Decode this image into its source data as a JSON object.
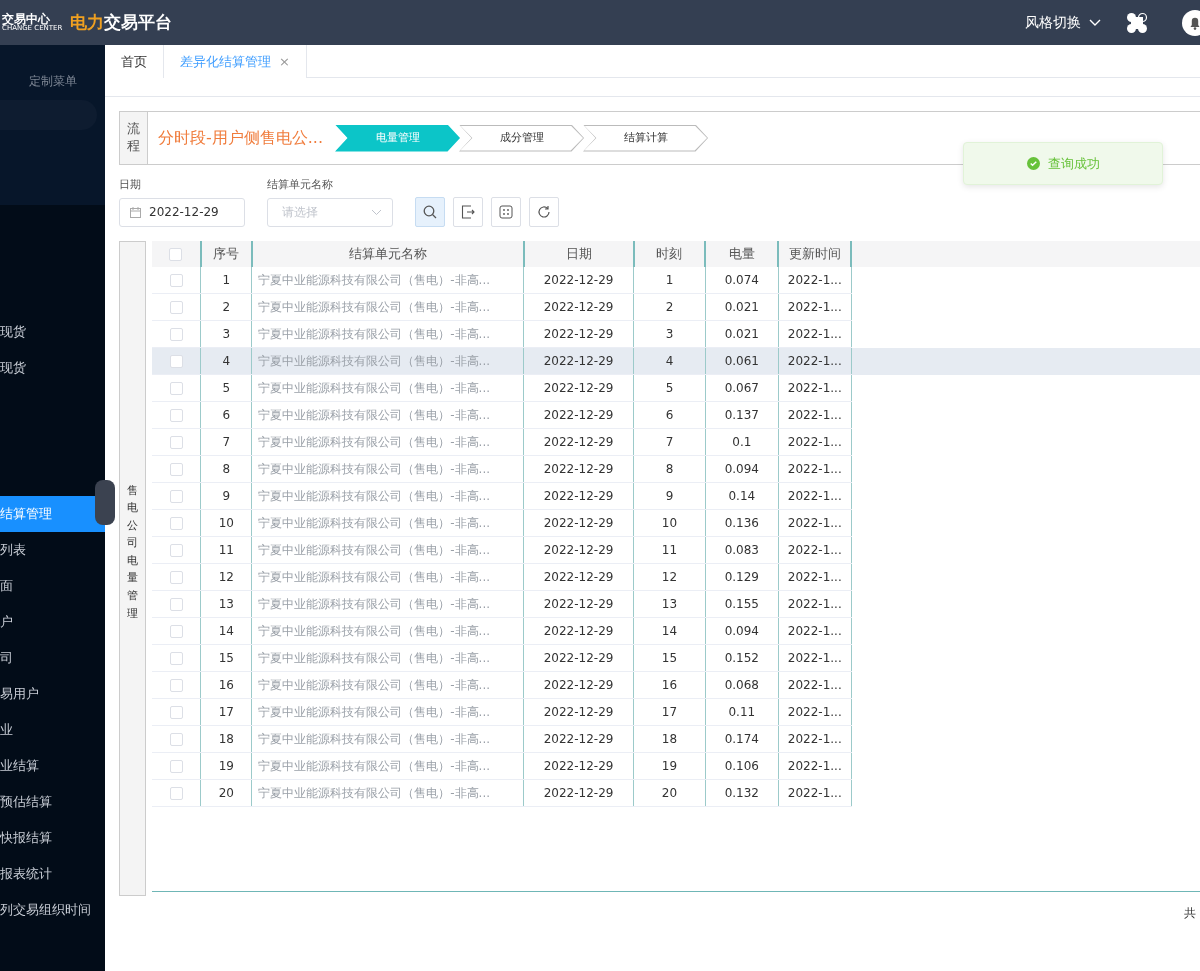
{
  "header": {
    "logo_cn": "交易中心",
    "logo_en": "CHANGE CENTER",
    "title_accent": "电力",
    "title_rest": "交易平台",
    "style_switch": "风格切换"
  },
  "sidebar": {
    "heading": "定制菜单",
    "items": [
      {
        "label": "现货",
        "selected": false
      },
      {
        "label": "现货",
        "selected": false
      },
      {
        "label": "结算管理",
        "selected": true
      },
      {
        "label": "列表",
        "selected": false
      },
      {
        "label": "面",
        "selected": false
      },
      {
        "label": "户",
        "selected": false
      },
      {
        "label": "司",
        "selected": false
      },
      {
        "label": "易用户",
        "selected": false
      },
      {
        "label": "业",
        "selected": false
      },
      {
        "label": "业结算",
        "selected": false
      },
      {
        "label": "预估结算",
        "selected": false
      },
      {
        "label": "快报结算",
        "selected": false
      },
      {
        "label": "报表统计",
        "selected": false
      },
      {
        "label": "列交易组织时间",
        "selected": false
      }
    ]
  },
  "tabs": [
    {
      "label": "首页",
      "selected": false,
      "closable": false
    },
    {
      "label": "差异化结算管理",
      "selected": true,
      "closable": true,
      "close": "×"
    }
  ],
  "toast": {
    "text": "查询成功"
  },
  "flow": {
    "label": "流程",
    "title": "分时段-用户侧售电公...",
    "steps": [
      {
        "label": "电量管理",
        "selected": true
      },
      {
        "label": "成分管理",
        "selected": false
      },
      {
        "label": "结算计算",
        "selected": false
      }
    ]
  },
  "filters": {
    "date_label": "日期",
    "date_value": "2022-12-29",
    "unit_label": "结算单元名称",
    "unit_placeholder": "请选择"
  },
  "panel_label": "售电公司电量管理",
  "table": {
    "select_all_checked": false,
    "columns": [
      "序号",
      "结算单元名称",
      "日期",
      "时刻",
      "电量",
      "更新时间"
    ],
    "rows": [
      {
        "checked": false,
        "hovered": false,
        "cells": [
          "1",
          "宁夏中业能源科技有限公司（售电）-非高...",
          "2022-12-29",
          "1",
          "0.074",
          "2022-1..."
        ]
      },
      {
        "checked": false,
        "hovered": false,
        "cells": [
          "2",
          "宁夏中业能源科技有限公司（售电）-非高...",
          "2022-12-29",
          "2",
          "0.021",
          "2022-1..."
        ]
      },
      {
        "checked": false,
        "hovered": false,
        "cells": [
          "3",
          "宁夏中业能源科技有限公司（售电）-非高...",
          "2022-12-29",
          "3",
          "0.021",
          "2022-1..."
        ]
      },
      {
        "checked": false,
        "hovered": true,
        "cells": [
          "4",
          "宁夏中业能源科技有限公司（售电）-非高...",
          "2022-12-29",
          "4",
          "0.061",
          "2022-1..."
        ]
      },
      {
        "checked": false,
        "hovered": false,
        "cells": [
          "5",
          "宁夏中业能源科技有限公司（售电）-非高...",
          "2022-12-29",
          "5",
          "0.067",
          "2022-1..."
        ]
      },
      {
        "checked": false,
        "hovered": false,
        "cells": [
          "6",
          "宁夏中业能源科技有限公司（售电）-非高...",
          "2022-12-29",
          "6",
          "0.137",
          "2022-1..."
        ]
      },
      {
        "checked": false,
        "hovered": false,
        "cells": [
          "7",
          "宁夏中业能源科技有限公司（售电）-非高...",
          "2022-12-29",
          "7",
          "0.1",
          "2022-1..."
        ]
      },
      {
        "checked": false,
        "hovered": false,
        "cells": [
          "8",
          "宁夏中业能源科技有限公司（售电）-非高...",
          "2022-12-29",
          "8",
          "0.094",
          "2022-1..."
        ]
      },
      {
        "checked": false,
        "hovered": false,
        "cells": [
          "9",
          "宁夏中业能源科技有限公司（售电）-非高...",
          "2022-12-29",
          "9",
          "0.14",
          "2022-1..."
        ]
      },
      {
        "checked": false,
        "hovered": false,
        "cells": [
          "10",
          "宁夏中业能源科技有限公司（售电）-非高...",
          "2022-12-29",
          "10",
          "0.136",
          "2022-1..."
        ]
      },
      {
        "checked": false,
        "hovered": false,
        "cells": [
          "11",
          "宁夏中业能源科技有限公司（售电）-非高...",
          "2022-12-29",
          "11",
          "0.083",
          "2022-1..."
        ]
      },
      {
        "checked": false,
        "hovered": false,
        "cells": [
          "12",
          "宁夏中业能源科技有限公司（售电）-非高...",
          "2022-12-29",
          "12",
          "0.129",
          "2022-1..."
        ]
      },
      {
        "checked": false,
        "hovered": false,
        "cells": [
          "13",
          "宁夏中业能源科技有限公司（售电）-非高...",
          "2022-12-29",
          "13",
          "0.155",
          "2022-1..."
        ]
      },
      {
        "checked": false,
        "hovered": false,
        "cells": [
          "14",
          "宁夏中业能源科技有限公司（售电）-非高...",
          "2022-12-29",
          "14",
          "0.094",
          "2022-1..."
        ]
      },
      {
        "checked": false,
        "hovered": false,
        "cells": [
          "15",
          "宁夏中业能源科技有限公司（售电）-非高...",
          "2022-12-29",
          "15",
          "0.152",
          "2022-1..."
        ]
      },
      {
        "checked": false,
        "hovered": false,
        "cells": [
          "16",
          "宁夏中业能源科技有限公司（售电）-非高...",
          "2022-12-29",
          "16",
          "0.068",
          "2022-1..."
        ]
      },
      {
        "checked": false,
        "hovered": false,
        "cells": [
          "17",
          "宁夏中业能源科技有限公司（售电）-非高...",
          "2022-12-29",
          "17",
          "0.11",
          "2022-1..."
        ]
      },
      {
        "checked": false,
        "hovered": false,
        "cells": [
          "18",
          "宁夏中业能源科技有限公司（售电）-非高...",
          "2022-12-29",
          "18",
          "0.174",
          "2022-1..."
        ]
      },
      {
        "checked": false,
        "hovered": false,
        "cells": [
          "19",
          "宁夏中业能源科技有限公司（售电）-非高...",
          "2022-12-29",
          "19",
          "0.106",
          "2022-1..."
        ]
      },
      {
        "checked": false,
        "hovered": false,
        "cells": [
          "20",
          "宁夏中业能源科技有限公司（售电）-非高...",
          "2022-12-29",
          "20",
          "0.132",
          "2022-1..."
        ]
      }
    ]
  },
  "pager_text": "共"
}
